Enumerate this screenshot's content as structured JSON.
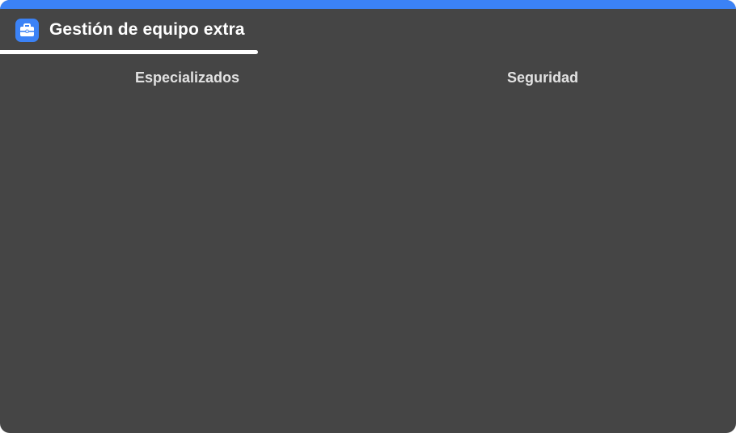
{
  "colors": {
    "accent": "#3b82f6",
    "panel_background": "#454545",
    "title_text": "#ffffff",
    "tab_text": "#e2e2e2"
  },
  "header": {
    "icon": "briefcase-icon",
    "title": "Gestión de equipo extra"
  },
  "tabs": [
    {
      "label": "Especializados"
    },
    {
      "label": "Seguridad"
    }
  ]
}
